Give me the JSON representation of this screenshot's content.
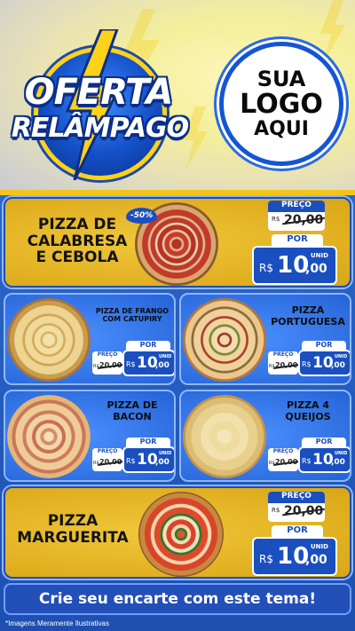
{
  "header": {
    "offer_line1": "OFERTA",
    "offer_line2": "RELÂMPAGO",
    "logo_line1": "SUA",
    "logo_line2": "LOGO",
    "logo_line3": "AQUI"
  },
  "products": [
    {
      "name_line1": "PIZZA DE",
      "name_line2": "CALABRESA",
      "name_line3": "E CEBOLA",
      "discount": "-50%",
      "old_label": "PREÇO",
      "old_currency": "R$",
      "old_price": "20,00",
      "por_label": "POR",
      "currency": "R$",
      "price_int": "10",
      "price_dec": ",00",
      "unit": "UNID"
    },
    {
      "name_line1": "PIZZA DE FRANGO",
      "name_line2": "COM CATUPIRY",
      "old_label": "PREÇO",
      "old_currency": "R$",
      "old_price": "20,00",
      "por_label": "POR",
      "currency": "R$",
      "price_int": "10",
      "price_dec": ",00",
      "unit": "UNID"
    },
    {
      "name_line1": "PIZZA",
      "name_line2": "PORTUGUESA",
      "old_label": "PREÇO",
      "old_currency": "R$",
      "old_price": "20,00",
      "por_label": "POR",
      "currency": "R$",
      "price_int": "10",
      "price_dec": ",00",
      "unit": "UNID"
    },
    {
      "name_line1": "PIZZA DE",
      "name_line2": "BACON",
      "old_label": "PREÇO",
      "old_currency": "R$",
      "old_price": "20,00",
      "por_label": "POR",
      "currency": "R$",
      "price_int": "10",
      "price_dec": ",00",
      "unit": "UNID"
    },
    {
      "name_line1": "PIZZA 4",
      "name_line2": "QUEIJOS",
      "old_label": "PREÇO",
      "old_currency": "R$",
      "old_price": "20,00",
      "por_label": "POR",
      "currency": "R$",
      "price_int": "10",
      "price_dec": ",00",
      "unit": "UNID"
    },
    {
      "name_line1": "PIZZA",
      "name_line2": "MARGUERITA",
      "old_label": "PREÇO",
      "old_currency": "R$",
      "old_price": "20,00",
      "por_label": "POR",
      "currency": "R$",
      "price_int": "10",
      "price_dec": ",00",
      "unit": "UNID"
    }
  ],
  "cta": "Crie seu encarte com este tema!",
  "footnote": "*Imagens Meramente Ilustrativas",
  "colors": {
    "blue": "#1a4fc0",
    "gold": "#e6b726",
    "accent_yellow": "#f3c51b"
  }
}
